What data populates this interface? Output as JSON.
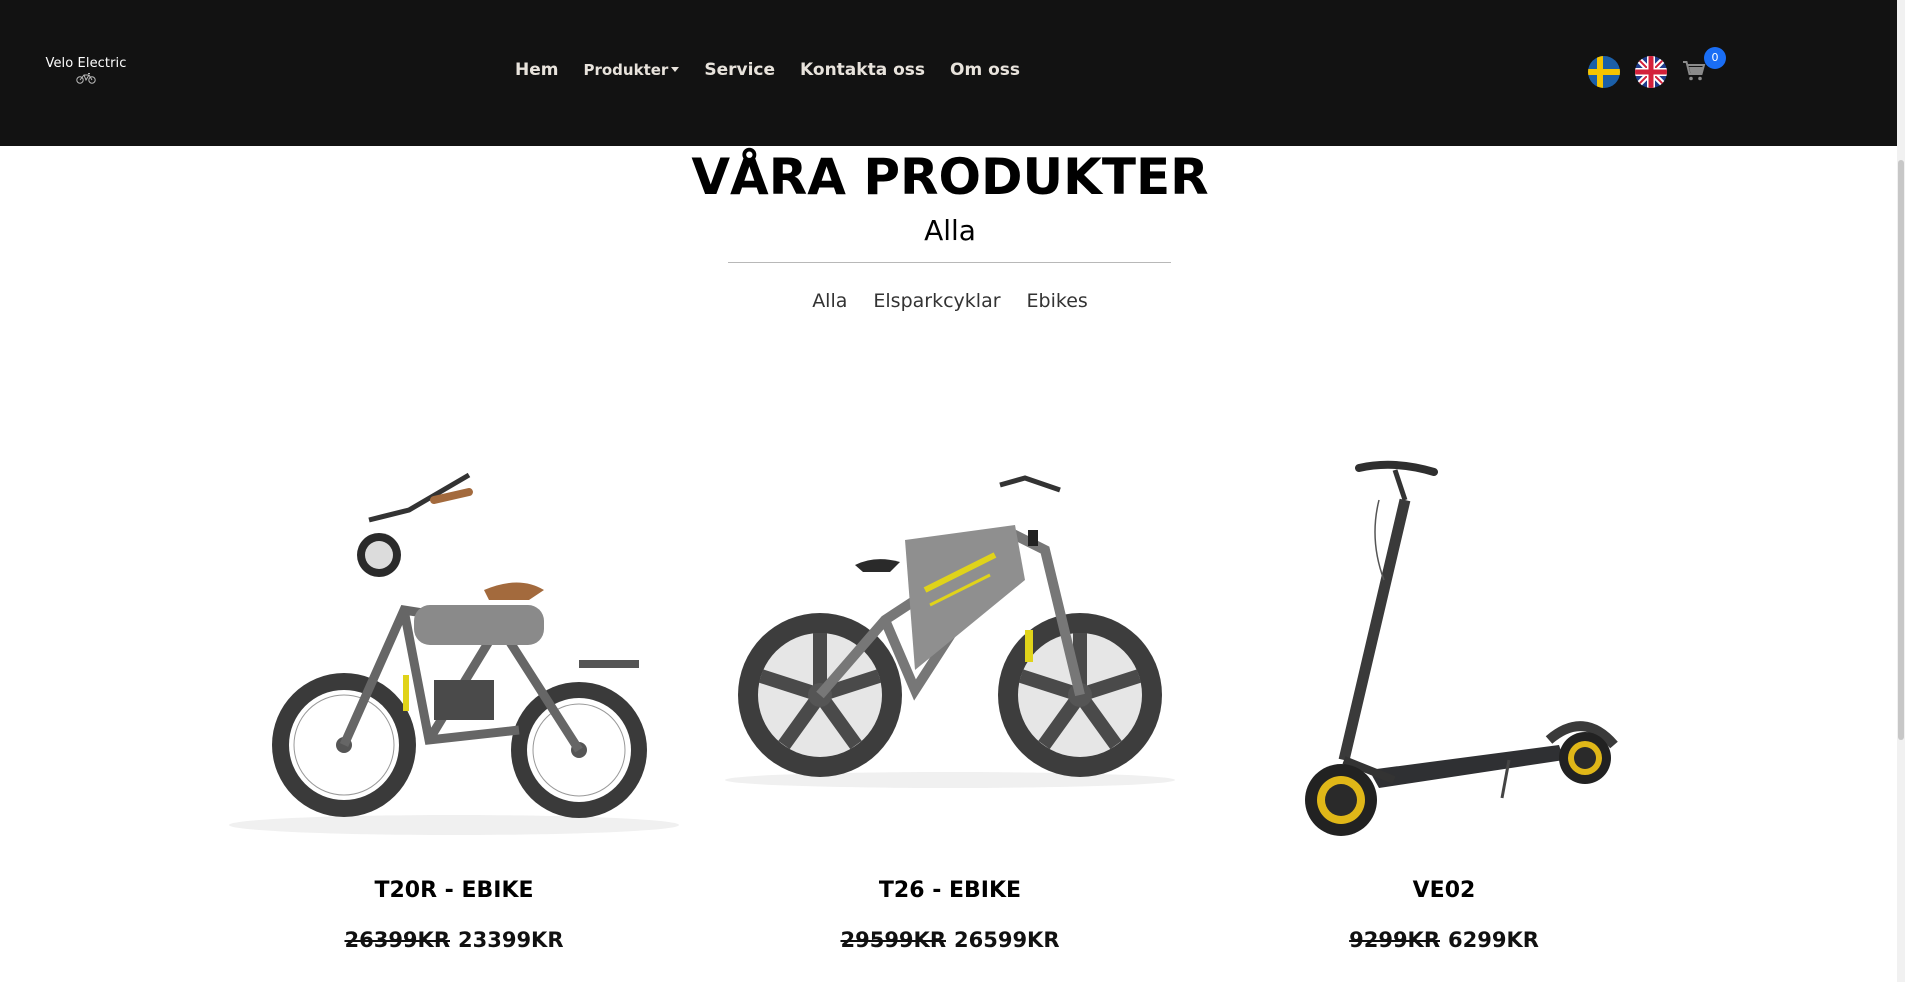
{
  "brand": {
    "logo_text": "Velo Electric",
    "logo_icon": "bike-icon"
  },
  "nav": {
    "items": [
      {
        "label": "Hem"
      },
      {
        "label": "Produkter"
      },
      {
        "label": "Service"
      },
      {
        "label": "Kontakta oss"
      },
      {
        "label": "Om oss"
      }
    ],
    "languages": [
      "swedish-flag-icon",
      "uk-flag-icon"
    ],
    "cart_icon": "cart-icon",
    "cart_count": "0"
  },
  "header": {
    "title": "VÅRA PRODUKTER",
    "subtitle": "Alla"
  },
  "filters": [
    {
      "label": "Alla"
    },
    {
      "label": "Elsparkcyklar"
    },
    {
      "label": "Ebikes"
    }
  ],
  "products": [
    {
      "name": "T20R - EBIKE",
      "old_price": "26399KR",
      "price": "23399KR",
      "image": "ebike-photo"
    },
    {
      "name": "T26 - EBIKE",
      "old_price": "29599KR",
      "price": "26599KR",
      "image": "ebike-photo"
    },
    {
      "name": "VE02",
      "old_price": "9299KR",
      "price": "6299KR",
      "image": "scooter-photo"
    }
  ],
  "colors": {
    "navbar_bg": "#121212",
    "nav_text": "#e8e3dc",
    "badge": "#1a6ef5",
    "accent_yellow": "#e0d31a"
  }
}
